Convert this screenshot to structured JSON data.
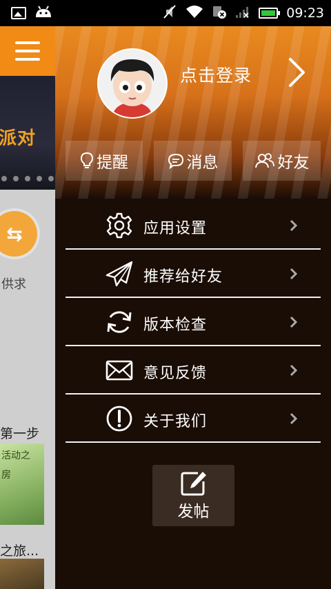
{
  "status_bar": {
    "time": "09:23",
    "icons": [
      "image-icon",
      "android-icon",
      "mute-icon",
      "wifi-icon",
      "sim-error-icon",
      "signal-icon",
      "battery-icon"
    ],
    "battery_color": "#36c63c"
  },
  "background_page": {
    "banner_text": "派对",
    "circle_label": "供求",
    "section_label": "第一步",
    "thumb_text_1": "活动之",
    "thumb_text_2": "房",
    "section_label_2": "之旅...",
    "accent_color": "#f28a16"
  },
  "drawer": {
    "login_text": "点击登录",
    "quick_actions": [
      {
        "label": "提醒",
        "icon": "lightbulb-icon"
      },
      {
        "label": "消息",
        "icon": "chat-bubble-icon"
      },
      {
        "label": "好友",
        "icon": "friends-icon"
      }
    ],
    "menu": [
      {
        "label": "应用设置",
        "icon": "gear-icon"
      },
      {
        "label": "推荐给好友",
        "icon": "paper-plane-icon"
      },
      {
        "label": "版本检查",
        "icon": "refresh-icon"
      },
      {
        "label": "意见反馈",
        "icon": "envelope-icon"
      },
      {
        "label": "关于我们",
        "icon": "info-icon"
      }
    ],
    "post_button_label": "发帖"
  }
}
